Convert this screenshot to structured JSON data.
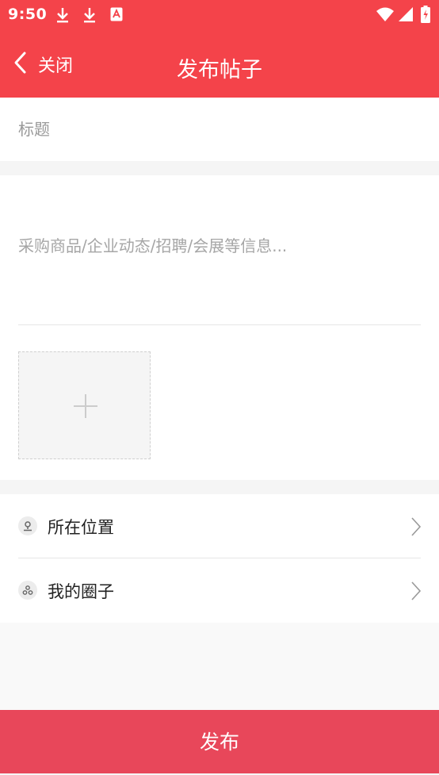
{
  "status_bar": {
    "time": "9:50",
    "icons": [
      "download-icon",
      "download-icon",
      "app-notification-icon",
      "wifi-icon",
      "signal-icon",
      "battery-icon"
    ]
  },
  "header": {
    "back_label": "关闭",
    "title": "发布帖子",
    "background_color": "#f4434a"
  },
  "form": {
    "title_placeholder": "标题",
    "content_placeholder": "采购商品/企业动态/招聘/会展等信息...",
    "add_image_icon": "plus-icon"
  },
  "options": [
    {
      "label": "所在位置",
      "icon": "location-icon"
    },
    {
      "label": "我的圈子",
      "icon": "circle-group-icon"
    }
  ],
  "footer": {
    "publish_label": "发布",
    "button_color": "#e8475a"
  }
}
